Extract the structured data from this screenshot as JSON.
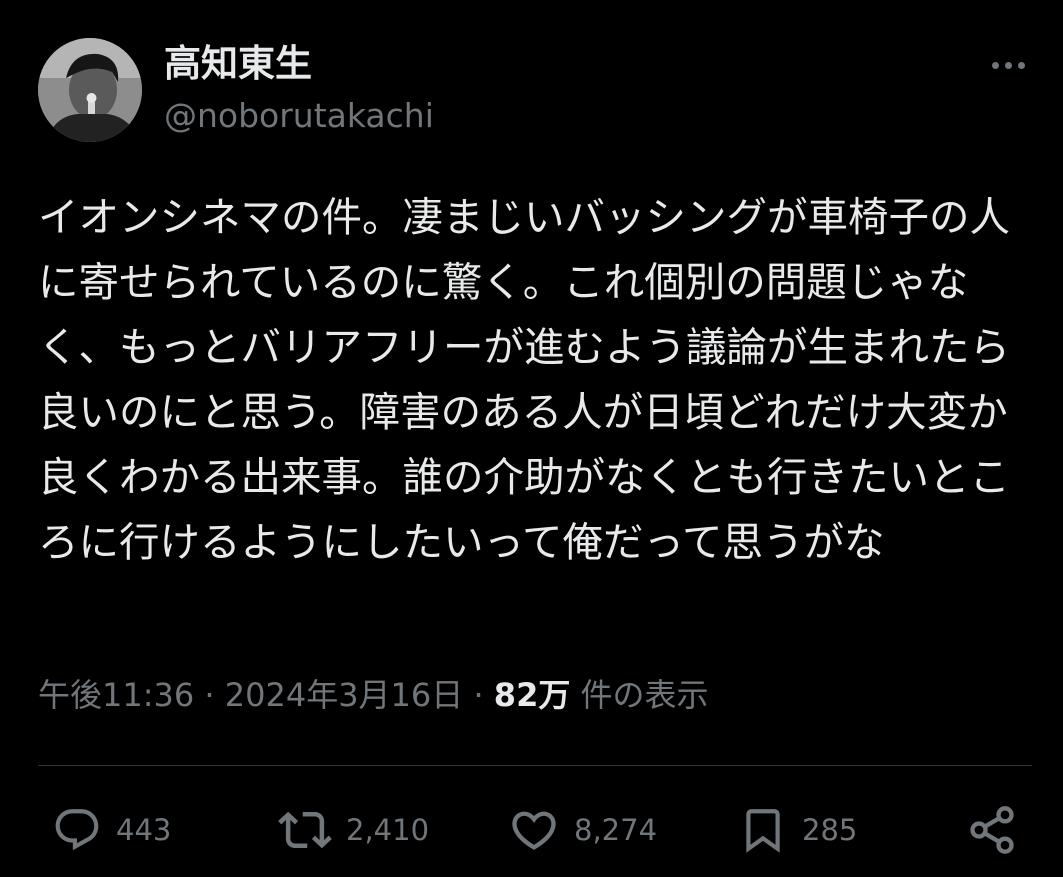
{
  "author": {
    "display_name": "高知東生",
    "handle": "@noborutakachi",
    "avatar_icon": "profile-photo"
  },
  "post": {
    "text": "イオンシネマの件。凄まじいバッシングが車椅子の人に寄せられているのに驚く。これ個別の問題じゃなく、もっとバリアフリーが進むよう議論が生まれたら良いのにと思う。障害のある人が日頃どれだけ大変か良くわかる出来事。誰の介助がなくとも行きたいところに行けるようにしたいって俺だって思うがな"
  },
  "meta": {
    "time": "午後11:36",
    "separator": "·",
    "date": "2024年3月16日",
    "views_count": "82万",
    "views_label": "件の表示"
  },
  "actions": {
    "replies": "443",
    "reposts": "2,410",
    "likes": "8,274",
    "bookmarks": "285"
  },
  "icons": {
    "more": "more-horizontal-icon",
    "reply": "reply-icon",
    "repost": "repost-icon",
    "like": "heart-icon",
    "bookmark": "bookmark-icon",
    "share": "share-icon"
  },
  "colors": {
    "background": "#000000",
    "primary_text": "#e7e9ea",
    "secondary_text": "#71767b",
    "divider": "#2f3336"
  }
}
